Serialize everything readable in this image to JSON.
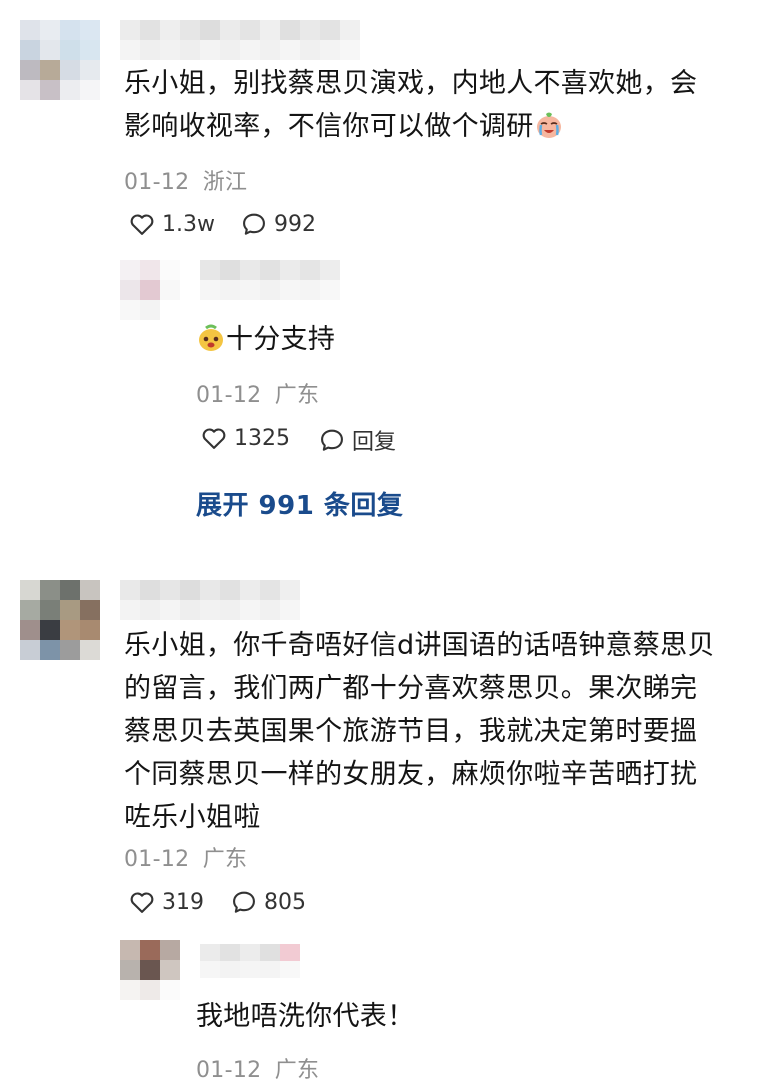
{
  "comments": [
    {
      "text": "乐小姐，别找蔡思贝演戏，内地人不喜欢她，会影响收视率，不信你可以做个调研",
      "line1": "乐小姐，别找蔡思贝演戏，内地人不喜欢她，会",
      "line2": "影响收视率，不信你可以做个调研",
      "emoji": "crying-face-emoji",
      "date": "01-12",
      "location": "浙江",
      "likes": "1.3w",
      "replies_count": "992",
      "replies": [
        {
          "emoji": "supportive-face-emoji",
          "text": "十分支持",
          "date": "01-12",
          "location": "广东",
          "likes": "1325",
          "reply_label": "回复"
        }
      ],
      "expand_label": "展开 991 条回复"
    },
    {
      "text": "乐小姐，你千奇唔好信d讲国语的话唔钟意蔡思贝的留言，我们两广都十分喜欢蔡思贝。果次睇完蔡思贝去英国果个旅游节目，我就决定第时要搵个同蔡思贝一样的女朋友，麻烦你啦辛苦晒打扰咗乐小姐啦",
      "lines": [
        "乐小姐，你千奇唔好信d讲国语的话唔钟意蔡思贝",
        "的留言，我们两广都十分喜欢蔡思贝。果次睇完",
        "蔡思贝去英国果个旅游节目，我就决定第时要搵",
        "个同蔡思贝一样的女朋友，麻烦你啦辛苦晒打扰",
        "咗乐小姐啦"
      ],
      "date": "01-12",
      "location": "广东",
      "likes": "319",
      "replies_count": "805",
      "replies": [
        {
          "text": "我地唔洗你代表！",
          "date": "01-12",
          "location": "广东"
        }
      ]
    }
  ],
  "icons": {
    "like": "heart-outline-icon",
    "comment": "speech-bubble-icon"
  },
  "colors": {
    "text": "#141414",
    "meta": "#8f8f8f",
    "link": "#1a4b8c"
  }
}
